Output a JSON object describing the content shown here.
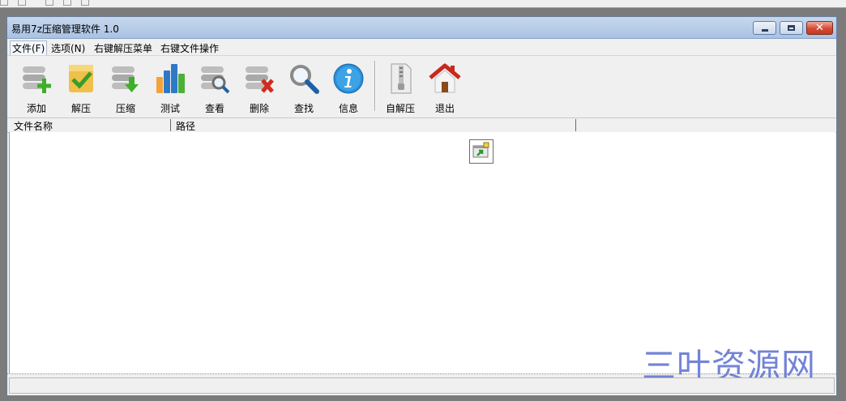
{
  "window": {
    "title": "易用7z压缩管理软件 1.0",
    "close_glyph": "✕"
  },
  "menu": [
    {
      "label": "文件(F)"
    },
    {
      "label": "选项(N)"
    },
    {
      "label": "右键解压菜单"
    },
    {
      "label": "右键文件操作"
    }
  ],
  "toolbar": [
    {
      "label": "添加",
      "icon": "add-icon"
    },
    {
      "label": "解压",
      "icon": "extract-icon"
    },
    {
      "label": "压缩",
      "icon": "compress-icon"
    },
    {
      "label": "测试",
      "icon": "test-chart-icon"
    },
    {
      "label": "查看",
      "icon": "view-icon"
    },
    {
      "label": "删除",
      "icon": "delete-icon"
    },
    {
      "label": "查找",
      "icon": "search-icon"
    },
    {
      "label": "信息",
      "icon": "info-icon"
    },
    {
      "label": "自解压",
      "icon": "sfx-zipper-icon"
    },
    {
      "label": "退出",
      "icon": "home-exit-icon"
    }
  ],
  "columns": [
    "文件名称",
    "路径"
  ],
  "watermark": "三叶资源网",
  "colors": {
    "titlebar": "#b8cde8",
    "close": "#d54a33",
    "watermark": "#5b6fd0"
  }
}
